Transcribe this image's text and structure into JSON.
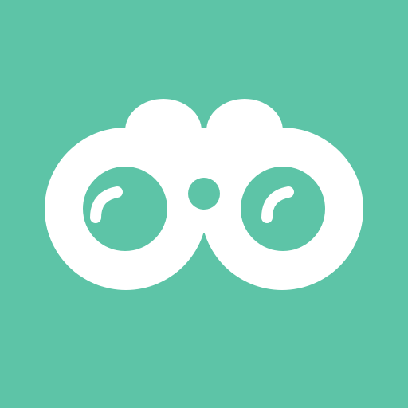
{
  "icon": {
    "name": "binoculars-icon",
    "background_color": "#5DC4A7",
    "glyph_color": "#FFFFFF"
  }
}
